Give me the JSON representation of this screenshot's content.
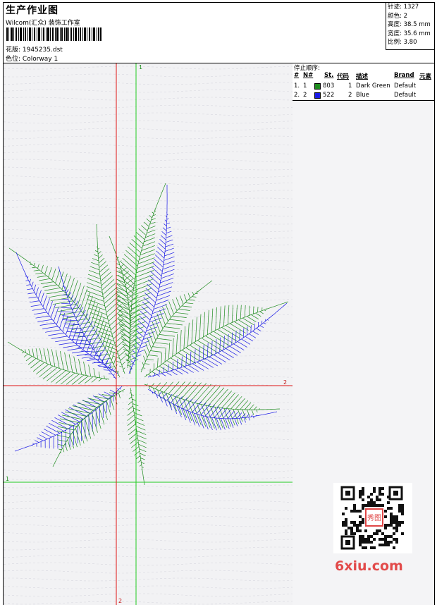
{
  "header": {
    "title": "生产作业图",
    "company": "Wilcom(汇众) 装饰工作室",
    "design_label": "花版:",
    "design_file": "1945235.dst",
    "colorway_label": "色位:",
    "colorway": "Colorway 1"
  },
  "stats": {
    "stitches": "针迹: 1327",
    "colors": "颜色: 2",
    "height": "高度: 38.5 mm",
    "width": "宽度: 35.6 mm",
    "scale": "比例: 3.80"
  },
  "stop_sequence": {
    "caption": "停止顺序:",
    "headers": [
      "#",
      "N#",
      "St.",
      "代码",
      "描述",
      "Brand",
      "元素"
    ],
    "rows": [
      {
        "num": "1.",
        "n": "1",
        "color": "#1e8c1e",
        "code": "803",
        "st": "1",
        "desc": "Dark Green",
        "brand": "Default"
      },
      {
        "num": "2.",
        "n": "2",
        "color": "#1a1ae6",
        "code": "522",
        "st": "2",
        "desc": "Blue",
        "brand": "Default"
      }
    ]
  },
  "canvas": {
    "axis_labels": {
      "green_top": "1",
      "green_left": "1",
      "red_right": "2",
      "red_bottom": "2"
    },
    "colors": {
      "green": "#1e8c1e",
      "blue": "#1a1ae6",
      "green_axis": "#22cc22",
      "red_axis": "#e01414"
    }
  },
  "watermark": {
    "brand": "6xiu.com",
    "seal": "秀图"
  }
}
